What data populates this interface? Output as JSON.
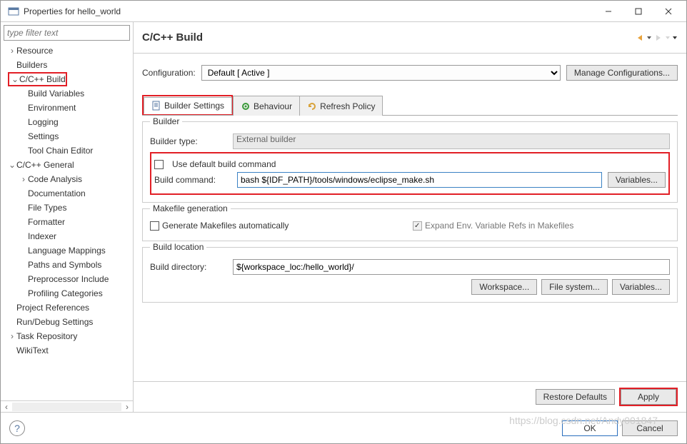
{
  "window": {
    "title": "Properties for hello_world"
  },
  "sidebar": {
    "filter_placeholder": "type filter text",
    "items": [
      {
        "label": "Resource",
        "level": 1,
        "exp": "›"
      },
      {
        "label": "Builders",
        "level": 1,
        "exp": " "
      },
      {
        "label": "C/C++ Build",
        "level": 1,
        "exp": "⌄",
        "highlight": true
      },
      {
        "label": "Build Variables",
        "level": 2,
        "exp": " "
      },
      {
        "label": "Environment",
        "level": 2,
        "exp": " "
      },
      {
        "label": "Logging",
        "level": 2,
        "exp": " "
      },
      {
        "label": "Settings",
        "level": 2,
        "exp": " "
      },
      {
        "label": "Tool Chain Editor",
        "level": 2,
        "exp": " "
      },
      {
        "label": "C/C++ General",
        "level": 1,
        "exp": "⌄"
      },
      {
        "label": "Code Analysis",
        "level": 2,
        "exp": "›"
      },
      {
        "label": "Documentation",
        "level": 2,
        "exp": " "
      },
      {
        "label": "File Types",
        "level": 2,
        "exp": " "
      },
      {
        "label": "Formatter",
        "level": 2,
        "exp": " "
      },
      {
        "label": "Indexer",
        "level": 2,
        "exp": " "
      },
      {
        "label": "Language Mappings",
        "level": 2,
        "exp": " "
      },
      {
        "label": "Paths and Symbols",
        "level": 2,
        "exp": " "
      },
      {
        "label": "Preprocessor Include",
        "level": 2,
        "exp": " "
      },
      {
        "label": "Profiling Categories",
        "level": 2,
        "exp": " "
      },
      {
        "label": "Project References",
        "level": 1,
        "exp": " "
      },
      {
        "label": "Run/Debug Settings",
        "level": 1,
        "exp": " "
      },
      {
        "label": "Task Repository",
        "level": 1,
        "exp": "›"
      },
      {
        "label": "WikiText",
        "level": 1,
        "exp": " "
      }
    ]
  },
  "header": {
    "title": "C/C++ Build"
  },
  "config": {
    "label": "Configuration:",
    "value": "Default  [ Active ]",
    "manage": "Manage Configurations..."
  },
  "tabs": {
    "builder_settings": "Builder Settings",
    "behaviour": "Behaviour",
    "refresh": "Refresh Policy"
  },
  "builder": {
    "legend": "Builder",
    "type_label": "Builder type:",
    "type_value": "External builder",
    "use_default": "Use default build command",
    "cmd_label": "Build command:",
    "cmd_value": "bash ${IDF_PATH}/tools/windows/eclipse_make.sh",
    "variables": "Variables..."
  },
  "makefile": {
    "legend": "Makefile generation",
    "generate": "Generate Makefiles automatically",
    "expand": "Expand Env. Variable Refs in Makefiles"
  },
  "buildloc": {
    "legend": "Build location",
    "dir_label": "Build directory:",
    "dir_value": "${workspace_loc:/hello_world}/",
    "workspace": "Workspace...",
    "filesystem": "File system...",
    "variables": "Variables..."
  },
  "footer": {
    "restore": "Restore Defaults",
    "apply": "Apply",
    "ok": "OK",
    "cancel": "Cancel"
  },
  "watermark": "https://blog.csdn.net/Andy001847"
}
